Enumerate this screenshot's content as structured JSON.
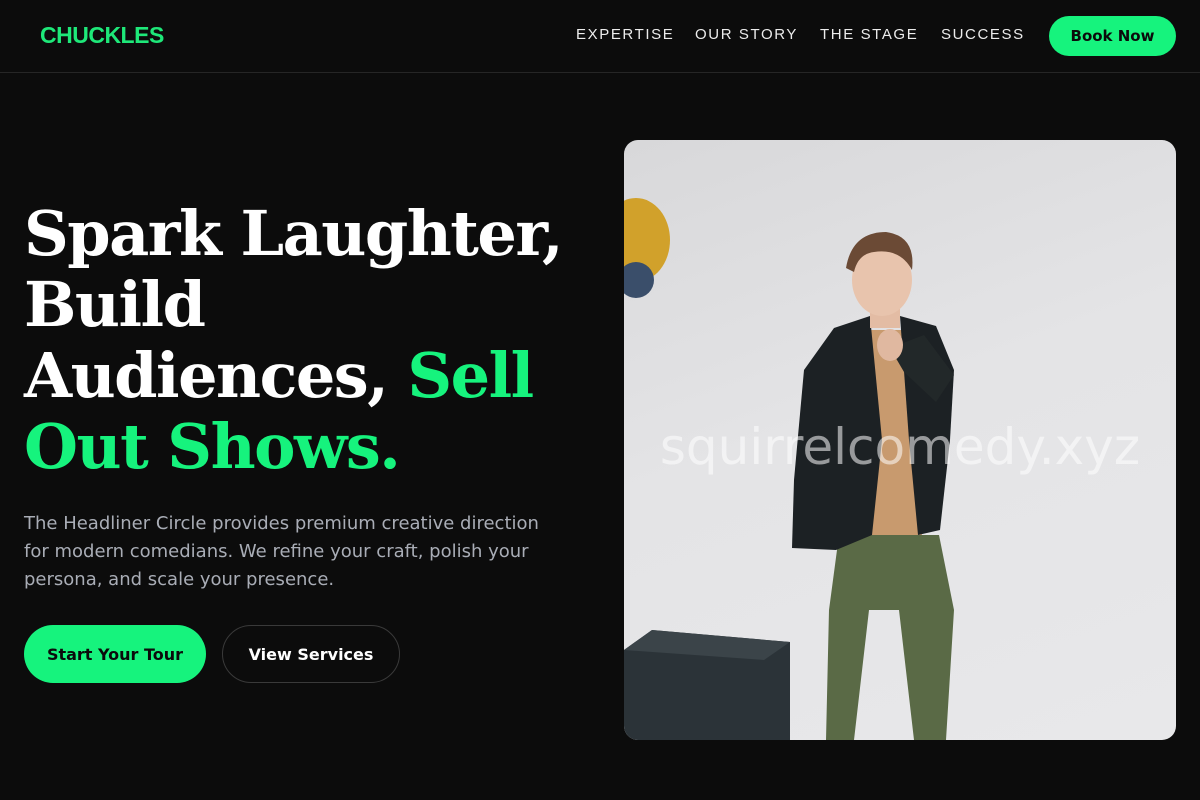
{
  "brand": {
    "logo_text": "CHUCKLES",
    "accent_color": "#16f37d"
  },
  "nav": {
    "links": [
      {
        "label": "EXPERTISE"
      },
      {
        "label": "OUR STORY"
      },
      {
        "label": "THE STAGE"
      },
      {
        "label": "SUCCESS"
      }
    ],
    "cta_label": "Book Now"
  },
  "hero": {
    "headline_white_1": "Spark Laughter,",
    "headline_white_2": "Build",
    "headline_white_3": "Audiences,",
    "headline_accent_1": "Sell",
    "headline_accent_2": "Out Shows.",
    "description": "The Headliner Circle provides premium creative direction for modern comedians. We refine your craft, polish your persona, and scale your presence.",
    "primary_button": "Start Your Tour",
    "secondary_button": "View Services",
    "image_watermark": "squirrelcomedy.xyz"
  },
  "colors": {
    "background": "#0c0c0c",
    "text_muted": "#a9adb6",
    "border": "#262626"
  }
}
